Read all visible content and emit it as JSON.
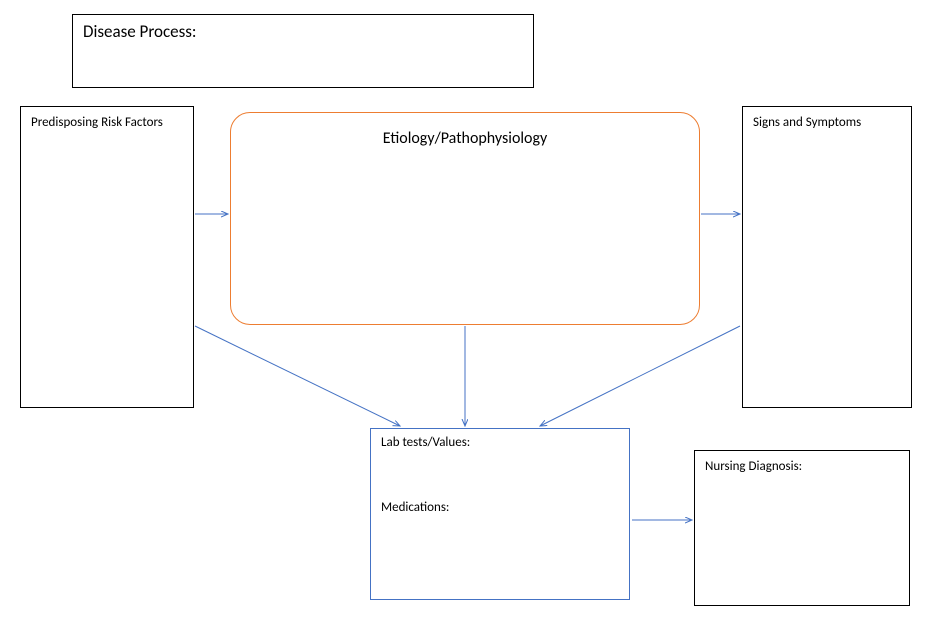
{
  "diseaseProcess": {
    "label": "Disease Process:"
  },
  "riskFactors": {
    "label": "Predisposing Risk Factors"
  },
  "etiology": {
    "label": "Etiology/Pathophysiology"
  },
  "signsSymptoms": {
    "label": "Signs and Symptoms"
  },
  "labTests": {
    "label": "Lab tests/Values:"
  },
  "medications": {
    "label": "Medications:"
  },
  "nursingDiagnosis": {
    "label": "Nursing Diagnosis:"
  }
}
